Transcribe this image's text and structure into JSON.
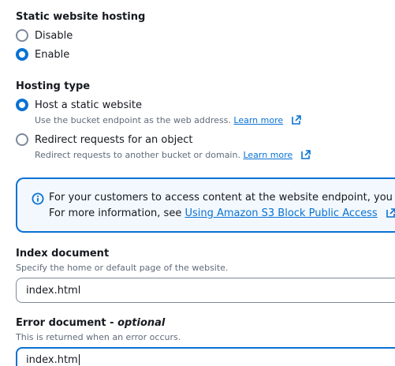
{
  "static_hosting": {
    "label": "Static website hosting",
    "options": [
      {
        "label": "Disable",
        "checked": false
      },
      {
        "label": "Enable",
        "checked": true
      }
    ]
  },
  "hosting_type": {
    "label": "Hosting type",
    "options": [
      {
        "label": "Host a static website",
        "checked": true,
        "description": "Use the bucket endpoint as the web address.",
        "link": "Learn more"
      },
      {
        "label": "Redirect requests for an object",
        "checked": false,
        "description": "Redirect requests to another bucket or domain.",
        "link": "Learn more"
      }
    ]
  },
  "info_alert": {
    "line1": "For your customers to access content at the website endpoint, you mu",
    "line2_prefix": "For more information, see ",
    "line2_link": "Using Amazon S3 Block Public Access"
  },
  "index_document": {
    "label": "Index document",
    "description": "Specify the home or default page of the website.",
    "value": "index.html"
  },
  "error_document": {
    "label": "Error document - ",
    "label_optional": "optional",
    "description": "This is returned when an error occurs.",
    "value": "index.html"
  },
  "colors": {
    "accent": "#0972d3",
    "info_background": "#f2f8fd",
    "text": "#16191f",
    "secondary_text": "#5f6b7a",
    "input_border": "#7d8998"
  },
  "icons": [
    "external-link-icon",
    "info-icon"
  ]
}
